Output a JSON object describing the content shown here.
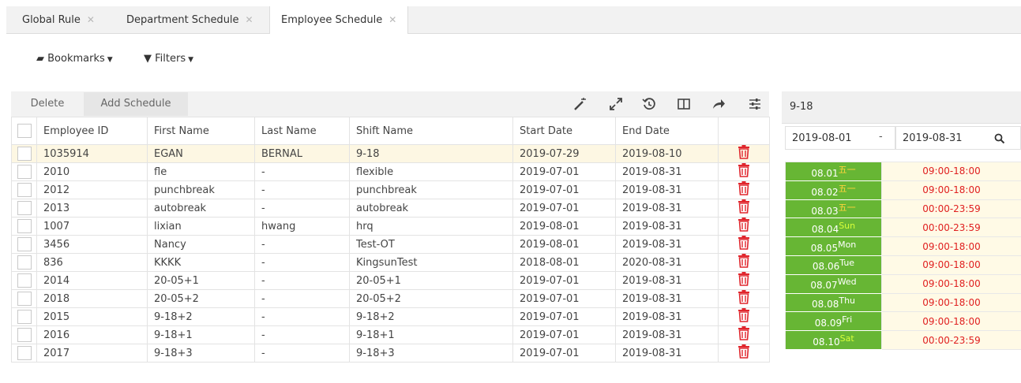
{
  "tabs": [
    {
      "label": "Global Rule"
    },
    {
      "label": "Department Schedule"
    },
    {
      "label": "Employee Schedule"
    }
  ],
  "toolbar": {
    "bookmarks": "Bookmarks",
    "filters": "Filters"
  },
  "actions": {
    "delete": "Delete",
    "add_schedule": "Add Schedule"
  },
  "table": {
    "columns": [
      "Employee ID",
      "First Name",
      "Last Name",
      "Shift Name",
      "Start Date",
      "End Date"
    ],
    "rows": [
      [
        "1035914",
        "EGAN",
        "BERNAL",
        "9-18",
        "2019-07-29",
        "2019-08-10"
      ],
      [
        "2010",
        "fle",
        "-",
        "flexible",
        "2019-07-01",
        "2019-08-31"
      ],
      [
        "2012",
        "punchbreak",
        "-",
        "punchbreak",
        "2019-07-01",
        "2019-08-31"
      ],
      [
        "2013",
        "autobreak",
        "-",
        "autobreak",
        "2019-07-01",
        "2019-08-31"
      ],
      [
        "1007",
        "lixian",
        "hwang",
        "hrq",
        "2019-08-01",
        "2019-08-31"
      ],
      [
        "3456",
        "Nancy",
        "-",
        "Test-OT",
        "2019-08-01",
        "2019-08-31"
      ],
      [
        "836",
        "KKKK",
        "-",
        "KingsunTest",
        "2018-08-01",
        "2020-08-31"
      ],
      [
        "2014",
        "20-05+1",
        "-",
        "20-05+1",
        "2019-07-01",
        "2019-08-31"
      ],
      [
        "2018",
        "20-05+2",
        "-",
        "20-05+2",
        "2019-07-01",
        "2019-08-31"
      ],
      [
        "2015",
        "9-18+2",
        "-",
        "9-18+2",
        "2019-07-01",
        "2019-08-31"
      ],
      [
        "2016",
        "9-18+1",
        "-",
        "9-18+1",
        "2019-07-01",
        "2019-08-31"
      ],
      [
        "2017",
        "9-18+3",
        "-",
        "9-18+3",
        "2019-07-01",
        "2019-08-31"
      ]
    ]
  },
  "side": {
    "title": "9-18",
    "start_date": "2019-08-01",
    "separator": "-",
    "end_date": "2019-08-31",
    "days": [
      {
        "date": "08.01",
        "weekday": "五一",
        "time": "09:00-18:00"
      },
      {
        "date": "08.02",
        "weekday": "五一",
        "time": "09:00-18:00"
      },
      {
        "date": "08.03",
        "weekday": "五一",
        "time": "00:00-23:59"
      },
      {
        "date": "08.04",
        "weekday": "Sun",
        "time": "00:00-23:59"
      },
      {
        "date": "08.05",
        "weekday": "Mon",
        "time": "09:00-18:00"
      },
      {
        "date": "08.06",
        "weekday": "Tue",
        "time": "09:00-18:00"
      },
      {
        "date": "08.07",
        "weekday": "Wed",
        "time": "09:00-18:00"
      },
      {
        "date": "08.08",
        "weekday": "Thu",
        "time": "09:00-18:00"
      },
      {
        "date": "08.09",
        "weekday": "Fri",
        "time": "09:00-18:00"
      },
      {
        "date": "08.10",
        "weekday": "Sat",
        "time": "00:00-23:59"
      }
    ]
  },
  "colors": {
    "accent_green": "#67b634",
    "delete_red": "#e0262d",
    "time_red": "#e02020",
    "highlight_row": "#fdf7e3"
  }
}
